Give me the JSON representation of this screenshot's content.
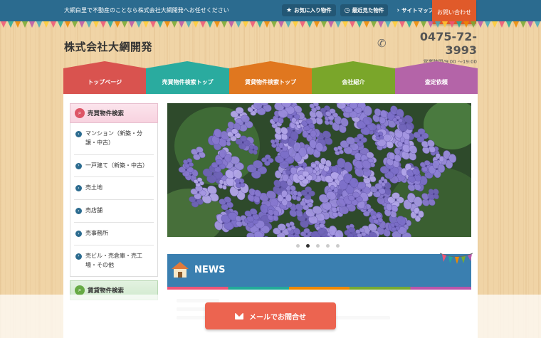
{
  "header": {
    "tagline": "大網白里で不動産のことなら株式会社大網開発へお任せください",
    "links": [
      {
        "label": "お気に入り物件",
        "icon": "star-icon"
      },
      {
        "label": "最近見た物件",
        "icon": "history-icon"
      },
      {
        "label": "サイトマップ",
        "icon": "chevron-right-icon"
      }
    ],
    "contact_tab": "お問い合わせ"
  },
  "logo": "株式会社大網開発",
  "phone": {
    "number": "0475-72-3993",
    "hours": "営業時間/9:00 〜19:00",
    "icon": "phone-icon"
  },
  "nav": [
    {
      "label": "トップページ",
      "color": "#d9534f"
    },
    {
      "label": "売買物件検索トップ",
      "color": "#2aab9f"
    },
    {
      "label": "賃貸物件検索トップ",
      "color": "#e0771f"
    },
    {
      "label": "会社紹介",
      "color": "#7aa62a"
    },
    {
      "label": "査定依頼",
      "color": "#b464a8"
    }
  ],
  "sidebar": {
    "sale_title": "売買物件検索",
    "sale_items": [
      "マンション（新築・分譲・中古）",
      "一戸建て（新築・中古）",
      "売土地",
      "売店舗",
      "売事務所",
      "売ビル・売倉庫・売工場・その他"
    ],
    "rent_title": "賃貸物件検索"
  },
  "slider": {
    "count": 5,
    "active_index": 1
  },
  "news": {
    "title": "NEWS"
  },
  "mail_button": "メールでお問合せ",
  "colors": {
    "topbar": "#2b6b8f",
    "accent": "#e05a2a",
    "mail": "#ec6450"
  }
}
